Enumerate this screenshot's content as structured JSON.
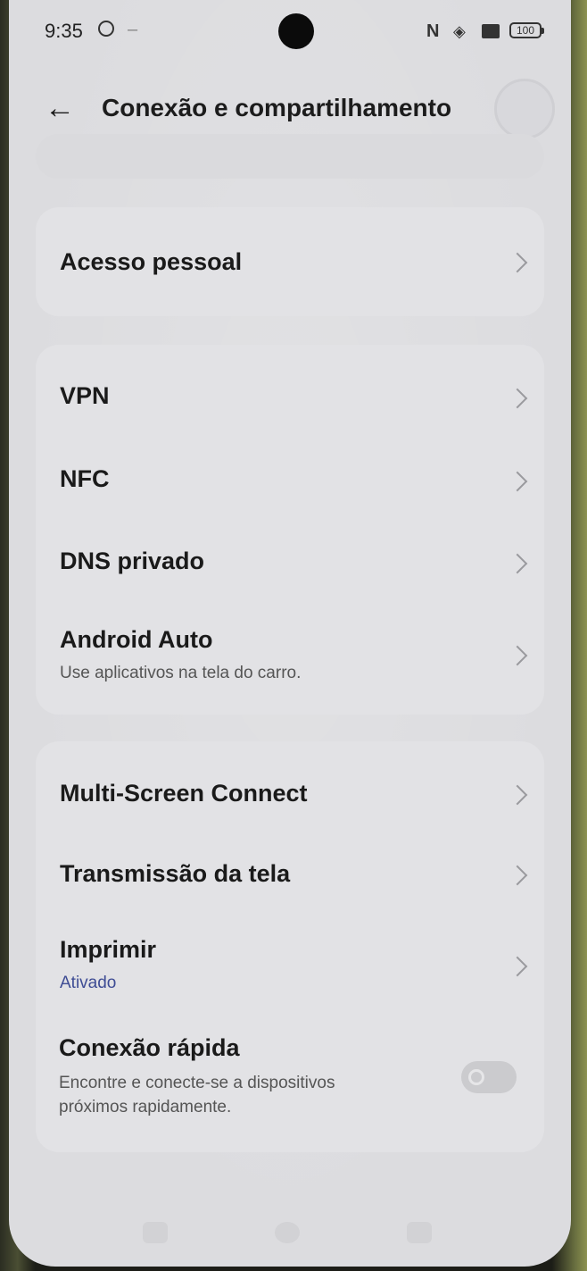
{
  "status_bar": {
    "time": "9:35",
    "icons": [
      "settings-icon",
      "nfc-icon",
      "wifi-icon",
      "sim-icon",
      "battery-icon"
    ],
    "nfc_glyph": "N",
    "battery": "100"
  },
  "header": {
    "title": "Conexão e compartilhamento",
    "back_icon": "arrow-left-icon"
  },
  "sections": {
    "hotspot": {
      "label": "Acesso pessoal"
    },
    "vpn": {
      "label": "VPN"
    },
    "nfc": {
      "label": "NFC"
    },
    "private_dns": {
      "label": "DNS privado"
    },
    "android_auto": {
      "label": "Android Auto",
      "subtitle": "Use aplicativos na tela do carro."
    },
    "multi_screen": {
      "label": "Multi-Screen Connect"
    },
    "screencast": {
      "label": "Transmissão da tela"
    },
    "print": {
      "label": "Imprimir",
      "status": "Ativado"
    },
    "quick_connect": {
      "label": "Conexão rápida",
      "subtitle_line1": "Encontre e conecte-se a dispositivos",
      "subtitle_line2": "próximos rapidamente.",
      "enabled": false
    }
  },
  "colors": {
    "background": "#dcdcdf",
    "card": "#e2e2e5",
    "accent": "#3e4c94"
  }
}
